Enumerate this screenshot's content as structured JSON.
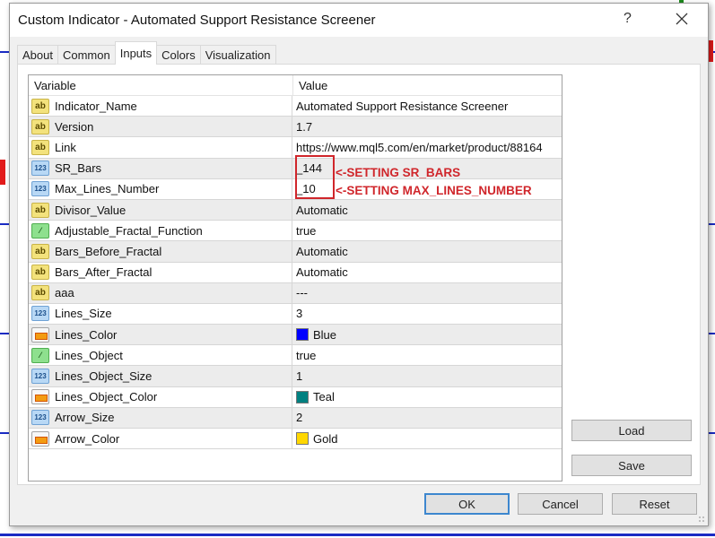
{
  "dialog": {
    "title": "Custom Indicator - Automated Support Resistance Screener",
    "help_label": "?",
    "close_icon": "close-icon"
  },
  "tabs": [
    {
      "label": "About",
      "active": false
    },
    {
      "label": "Common",
      "active": false
    },
    {
      "label": "Inputs",
      "active": true
    },
    {
      "label": "Colors",
      "active": false
    },
    {
      "label": "Visualization",
      "active": false
    }
  ],
  "grid": {
    "headers": {
      "variable": "Variable",
      "value": "Value"
    },
    "rows": [
      {
        "type": "string",
        "icon": "string-type-icon",
        "variable": "Indicator_Name",
        "value": "Automated Support Resistance Screener"
      },
      {
        "type": "string",
        "icon": "string-type-icon",
        "variable": "Version",
        "value": "1.7"
      },
      {
        "type": "string",
        "icon": "string-type-icon",
        "variable": "Link",
        "value": "https://www.mql5.com/en/market/product/88164"
      },
      {
        "type": "number",
        "icon": "integer-type-icon",
        "variable": "SR_Bars",
        "value": "_144"
      },
      {
        "type": "number",
        "icon": "integer-type-icon",
        "variable": "Max_Lines_Number",
        "value": "_10"
      },
      {
        "type": "string",
        "icon": "string-type-icon",
        "variable": "Divisor_Value",
        "value": "Automatic"
      },
      {
        "type": "bool",
        "icon": "boolean-type-icon",
        "variable": "Adjustable_Fractal_Function",
        "value": "true"
      },
      {
        "type": "string",
        "icon": "string-type-icon",
        "variable": "Bars_Before_Fractal",
        "value": "Automatic"
      },
      {
        "type": "string",
        "icon": "string-type-icon",
        "variable": "Bars_After_Fractal",
        "value": "Automatic"
      },
      {
        "type": "string",
        "icon": "string-type-icon",
        "variable": "aaa",
        "value": "---"
      },
      {
        "type": "number",
        "icon": "integer-type-icon",
        "variable": "Lines_Size",
        "value": "3"
      },
      {
        "type": "color",
        "icon": "color-type-icon",
        "variable": "Lines_Color",
        "value": "Blue",
        "swatch": "#0000ff"
      },
      {
        "type": "bool",
        "icon": "boolean-type-icon",
        "variable": "Lines_Object",
        "value": "true"
      },
      {
        "type": "number",
        "icon": "integer-type-icon",
        "variable": "Lines_Object_Size",
        "value": "1"
      },
      {
        "type": "color",
        "icon": "color-type-icon",
        "variable": "Lines_Object_Color",
        "value": "Teal",
        "swatch": "#008080"
      },
      {
        "type": "number",
        "icon": "integer-type-icon",
        "variable": "Arrow_Size",
        "value": "2"
      },
      {
        "type": "color",
        "icon": "color-type-icon",
        "variable": "Arrow_Color",
        "value": "Gold",
        "swatch": "#ffd700"
      }
    ]
  },
  "annotations": {
    "sr_bars": "<-SETTING SR_BARS",
    "max_lines": "<-SETTING MAX_LINES_NUMBER",
    "color": "#d0262b"
  },
  "side_buttons": {
    "load": "Load",
    "save": "Save"
  },
  "footer_buttons": {
    "ok": "OK",
    "cancel": "Cancel",
    "reset": "Reset"
  },
  "icon_glyphs": {
    "string": "ab",
    "number": "123",
    "bool": "⁄"
  }
}
